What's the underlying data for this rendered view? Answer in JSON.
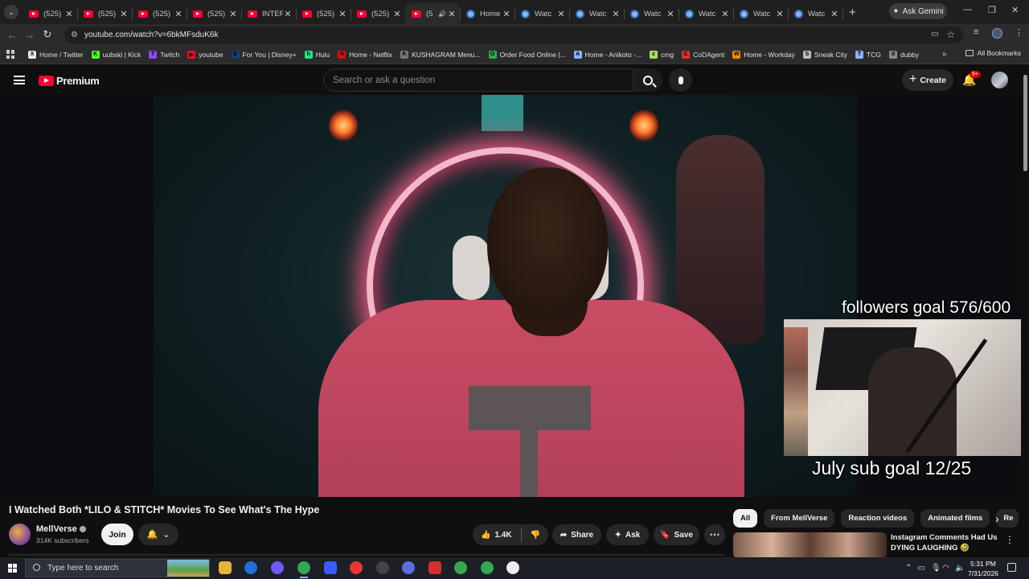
{
  "browser": {
    "tabs": [
      {
        "label": "(525)",
        "favicon": "youtube"
      },
      {
        "label": "(525)",
        "favicon": "youtube"
      },
      {
        "label": "(525)",
        "favicon": "youtube"
      },
      {
        "label": "(525)",
        "favicon": "youtube"
      },
      {
        "label": "INTER",
        "favicon": "youtube"
      },
      {
        "label": "(525)",
        "favicon": "youtube"
      },
      {
        "label": "(525)",
        "favicon": "youtube"
      },
      {
        "label": "(5",
        "favicon": "youtube",
        "active": true,
        "audio": true
      },
      {
        "label": "Home",
        "favicon": "globe"
      },
      {
        "label": "Watc",
        "favicon": "globe"
      },
      {
        "label": "Watc",
        "favicon": "globe"
      },
      {
        "label": "Watc",
        "favicon": "globe"
      },
      {
        "label": "Watc",
        "favicon": "globe"
      },
      {
        "label": "Watc",
        "favicon": "globe"
      },
      {
        "label": "Watc",
        "favicon": "globe"
      }
    ],
    "ask_gemini": "Ask Gemini",
    "url": "youtube.com/watch?v=6bkMFsduK6k",
    "bookmarks": [
      {
        "label": "Home / Twitter",
        "icon": "X",
        "color": "#e8e8e8"
      },
      {
        "label": "uubski | Kick",
        "icon": "K",
        "color": "#53fc18"
      },
      {
        "label": "Twitch",
        "icon": "T",
        "color": "#9146ff"
      },
      {
        "label": "youtube",
        "icon": "▶",
        "color": "#ff0033"
      },
      {
        "label": "For You | Disney+",
        "icon": "D",
        "color": "#1a3c7a"
      },
      {
        "label": "Hulu",
        "icon": "h",
        "color": "#1ce783"
      },
      {
        "label": "Home - Netflix",
        "icon": "N",
        "color": "#e50914"
      },
      {
        "label": "KUSHAGRAM Menu...",
        "icon": "K",
        "color": "#777777"
      },
      {
        "label": "Order Food Online |...",
        "icon": "O",
        "color": "#34a853"
      },
      {
        "label": "Home - Anikoto -...",
        "icon": "A",
        "color": "#8ab4f8"
      },
      {
        "label": "cmg",
        "icon": "c",
        "color": "#a8e063"
      },
      {
        "label": "CoDAgent",
        "icon": "C",
        "color": "#d9342b"
      },
      {
        "label": "Home - Workday",
        "icon": "W",
        "color": "#f38b00"
      },
      {
        "label": "Sneak City",
        "icon": "S",
        "color": "#bbbbbb"
      },
      {
        "label": "TCG",
        "icon": "T",
        "color": "#8ab4f8"
      },
      {
        "label": "dubby",
        "icon": "d",
        "color": "#888888"
      }
    ],
    "all_bookmarks": "All Bookmarks"
  },
  "youtube": {
    "logo_text": "Premium",
    "search_placeholder": "Search or ask a question",
    "create_label": "Create",
    "notif_badge": "9+",
    "video": {
      "overlay_followers": "followers goal 576/600",
      "overlay_subs": "July sub goal 12/25"
    },
    "title": "I Watched Both *LILO & STITCH* Movies To See What's The Hype",
    "channel": {
      "name": "MellVerse",
      "subscribers": "314K subscribers",
      "join_label": "Join"
    },
    "actions": {
      "likes": "1.4K",
      "share": "Share",
      "ask": "Ask",
      "save": "Save"
    },
    "chips": [
      "All",
      "From MellVerse",
      "Reaction videos",
      "Animated films",
      "Re"
    ],
    "recommendation": {
      "title": "Instagram Comments Had Us DYING LAUGHING 🤣"
    }
  },
  "taskbar": {
    "search_placeholder": "Type here to search",
    "time": "5:31 PM",
    "date": "7/31/2026"
  }
}
